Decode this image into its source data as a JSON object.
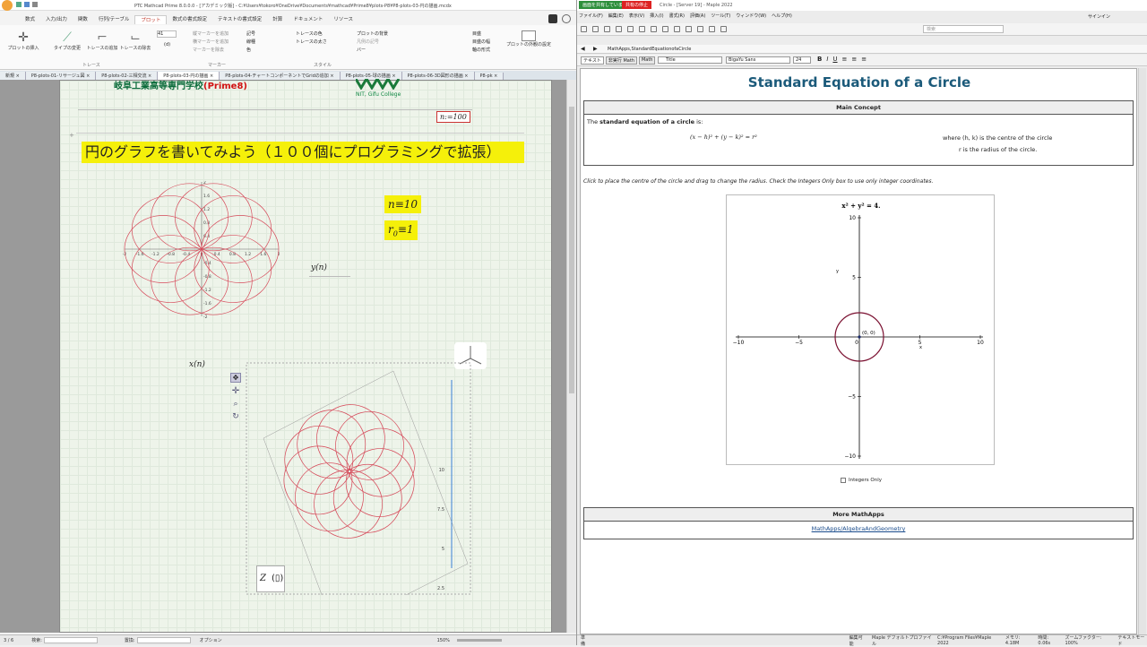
{
  "mathcad": {
    "title": "PTC Mathcad Prime 8.0.0.0 - [アカデミック版] - C:¥Users¥tokoro¥OneDrive¥Documents¥mathcad¥Prime8¥plots-P8¥P8-plots-03-円の描画.mcdx",
    "menu_tabs": [
      "数式",
      "入力/出力",
      "関数",
      "行列/テーブル",
      "プロット",
      "数式の書式設定",
      "テキストの書式設定",
      "計算",
      "ドキュメント",
      "リソース"
    ],
    "active_tab": "プロット",
    "ribbon": {
      "insert_plot": "プロットの挿入",
      "change_type": "タイプの変更",
      "add_trace": "トレースの追加",
      "remove_trace": "トレースの除去",
      "value": "41",
      "value2": "(d)",
      "markers": [
        "縦マーカーを追加",
        "横マーカーを追加",
        "マーカーを除去"
      ],
      "styles": [
        "記号",
        "線種",
        "色"
      ],
      "trace_color": "トレースの色",
      "trace_size": "トレースの太さ",
      "plot_bg": "プロットの背景",
      "symbols": "凡例の記号",
      "bars": "バー",
      "axis_opts": [
        "目盛",
        "目盛の幅",
        "軸の形式"
      ],
      "plot_settings": "プロットの外観の設定",
      "group_trace": "トレース",
      "group_marker": "マーカー",
      "group_style": "スタイル"
    },
    "doc_tabs": [
      "新規",
      "P8-plots-01-リサージュ図",
      "P8-plots-02-三相交流",
      "P8-plots-03-円の描画",
      "P8-plots-04-チャートコンポーネントでGridの追加",
      "P8-plots-05-球の描画",
      "P8-plots-06-3D図形の描画",
      "P8-pk"
    ],
    "active_doc": "P8-plots-03-円の描画",
    "header_text": "岐阜工業高等専門学校",
    "header_red": "(Prime8)",
    "college": "NIT, Gifu College",
    "n_def": "n:=100",
    "heading": "円のグラフを書いてみよう（１００個にプログラミングで拡張）",
    "n_eq": "n≡10",
    "r0": "r",
    "r0_sub": "0",
    "r0_val": "≡1",
    "ylabel": "y(n)",
    "xlabel": "x(n)",
    "z_label": "Z",
    "plot2d_ticks_x": [
      "-2",
      "-1.6",
      "-1.2",
      "-0.8",
      "-0.4",
      "0",
      "0.4",
      "0.8",
      "1.2",
      "1.6",
      "2"
    ],
    "plot2d_ticks_y": [
      "2",
      "1.6",
      "1.2",
      "0.8",
      "0.4",
      "0",
      "-0.4",
      "-0.8",
      "-1.2",
      "-1.6",
      "-2"
    ],
    "plot3d_ticks": [
      "10",
      "7.5",
      "5",
      "2.5",
      "0"
    ],
    "status": {
      "page": "3 / 6",
      "search": "検索:",
      "replace": "置換:",
      "options": "オプション",
      "zoom": "150%"
    }
  },
  "maple": {
    "title": "Circle - [Server 19] - Maple 2022",
    "sharing": "画面を共有しています",
    "stop_share": "共有の停止",
    "menu": [
      "ファイル(F)",
      "編集(E)",
      "表示(V)",
      "挿入(I)",
      "書式(R)",
      "評価(A)",
      "ツール(T)",
      "ウィンドウ(W)",
      "ヘルプ(H)"
    ],
    "signin": "サインイン",
    "search_placeholder": "検索",
    "path": "MathApps,StandardEquationofaCircle",
    "modes": [
      "テキスト",
      "非実行 Math",
      "Math"
    ],
    "style": "Title",
    "font": "BigaYu Sans",
    "size": "24",
    "page_title": "Standard Equation of a Circle",
    "main_concept": "Main Concept",
    "concept_pre": "The ",
    "concept_bold": "standard equation of a circle",
    "concept_post": " is:",
    "equation": "(x − h)² + (y − k)² = r²",
    "where1": "where (h, k) is the centre of the circle",
    "where2": "r is the radius of the circle.",
    "instruction": "Click to place the centre of the circle and drag to change the radius. Check the Integers Only box to use only integer coordinates.",
    "plot_title": "x² + y² = 4.",
    "plot_xlabel": "x",
    "plot_ylabel": "y",
    "x_ticks": [
      "−10",
      "−5",
      "0",
      "5",
      "10"
    ],
    "y_ticks": [
      "10",
      "5",
      "−5",
      "−10"
    ],
    "center_label": "(0, 0)",
    "integers_only": "Integers Only",
    "more": "More MathApps",
    "more_link": "MathApps/AlgebraAndGeometry",
    "status": {
      "ready": "準備",
      "edit": "編集可能",
      "profile": "Maple デフォルトプロファイル",
      "path": "C:¥Program Files¥Maple 2022",
      "mem": "メモリ: 4.18M",
      "time": "時間: 0.06s",
      "zoom": "ズームファクター: 100%",
      "mode": "テキストモード"
    }
  },
  "chart_data": [
    {
      "type": "line",
      "title": "",
      "desc_series": "10 circles of radius 1 centred on unit circle (n=10, r0=1)",
      "xlim": [
        -2,
        2
      ],
      "ylim": [
        -2,
        2
      ],
      "n": 10,
      "r0": 1
    },
    {
      "type": "line",
      "title": "x² + y² = 4.",
      "xlabel": "x",
      "ylabel": "y",
      "xlim": [
        -10,
        10
      ],
      "ylim": [
        -10,
        10
      ],
      "center": [
        0,
        0
      ],
      "radius": 2
    }
  ]
}
